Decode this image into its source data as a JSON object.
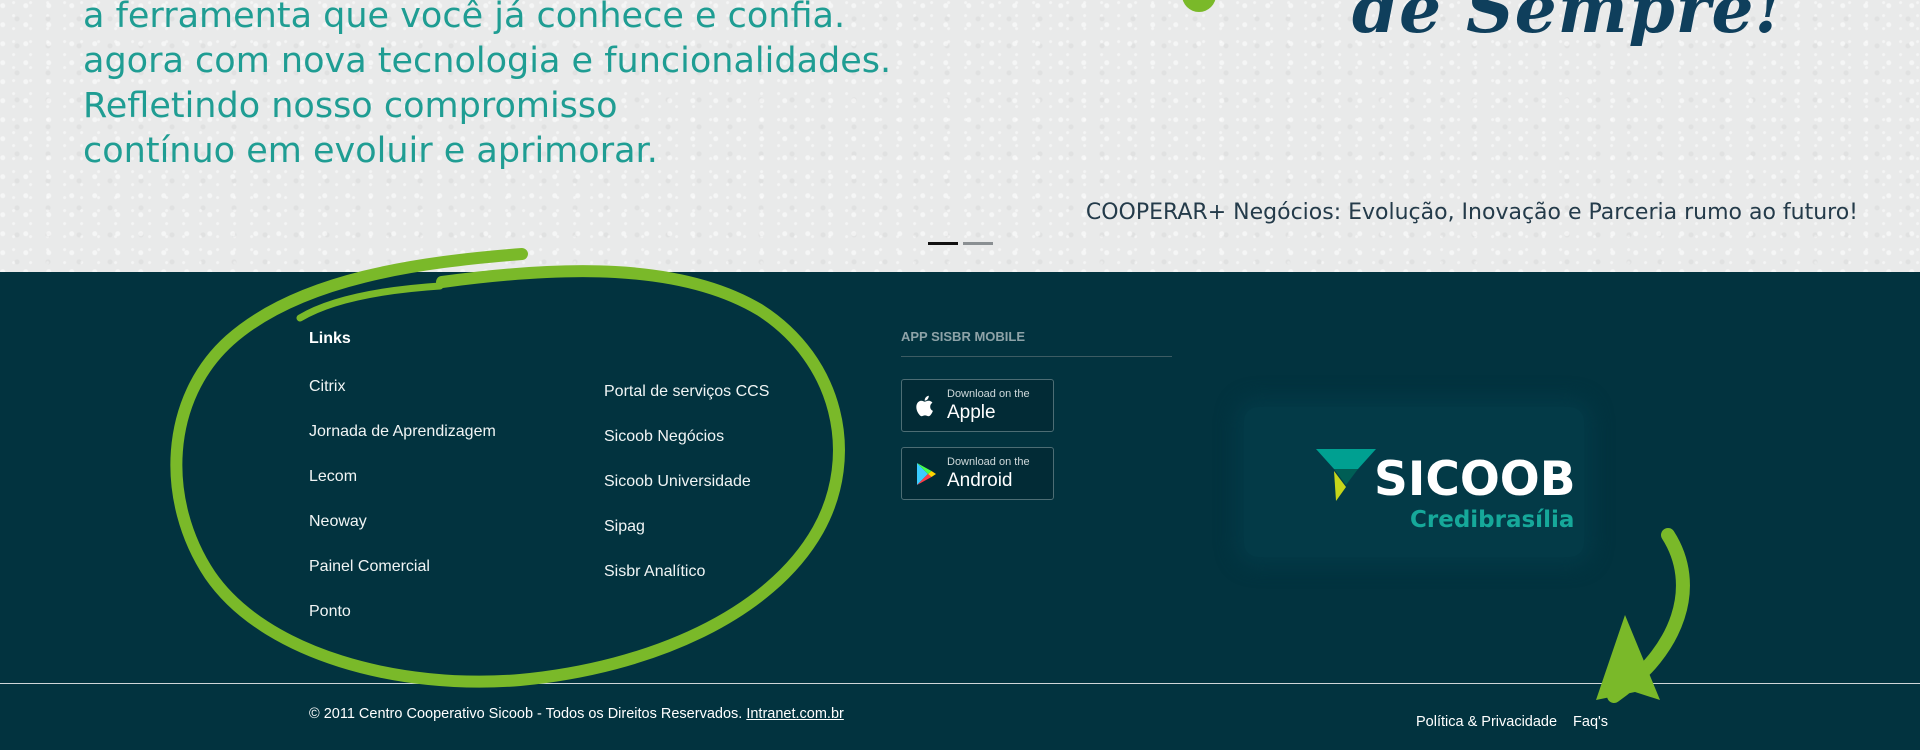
{
  "hero": {
    "lines": [
      "a ferramenta que você já conhece e confia.",
      "agora com nova tecnologia e funcionalidades.",
      "Refletindo nosso compromisso",
      "contínuo em evoluir e aprimorar."
    ],
    "script_text": "de Sempre!",
    "caption": "COOPERAR+ Negócios: Evolução, Inovação e Parceria rumo ao futuro!",
    "active_slide": 1,
    "slide_count": 2
  },
  "footer": {
    "links_title": "Links",
    "links_col1": [
      "Citrix",
      "Jornada de Aprendizagem",
      "Lecom",
      "Neoway",
      "Painel Comercial",
      "Ponto"
    ],
    "links_col2": [
      "Portal de serviços CCS",
      "Sicoob Negócios",
      "Sicoob Universidade",
      "Sipag",
      "Sisbr Analítico"
    ],
    "app_title": "APP SISBR MOBILE",
    "apple": {
      "small": "Download on the",
      "big": "Apple",
      "icon": "apple-icon"
    },
    "android": {
      "small": "Download on the",
      "big": "Android",
      "icon": "google-play-icon"
    },
    "logo": {
      "word": "SICOOB",
      "sub": "Credibrasília"
    },
    "copyright_text": "© 2011 Centro Cooperativo Sicoob - Todos os Direitos Reservados.",
    "copyright_link": "Intranet.com.br",
    "legal_links": [
      "Política & Privacidade",
      "Faq's"
    ]
  },
  "colors": {
    "footer_bg": "#02333f",
    "hero_text": "#1f9d93",
    "annotation_green": "#7ab929",
    "logo_teal": "#16a89a"
  }
}
